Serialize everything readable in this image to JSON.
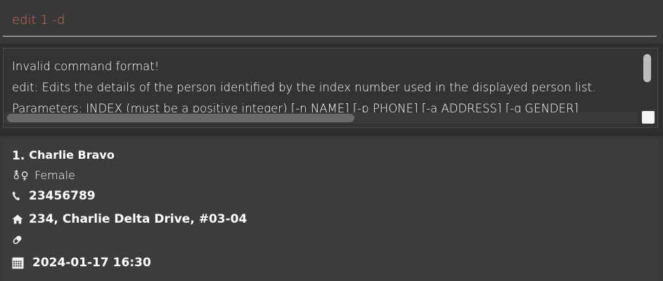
{
  "command_box": {
    "value": "edit 1 -d"
  },
  "result_display": {
    "lines": [
      "Invalid command format!",
      "edit: Edits the details of the person identified by the index number used in the displayed person list.",
      "Parameters: INDEX (must be a positive integer) [-n NAME] [-p PHONE] [-a ADDRESS] [-g GENDER]"
    ]
  },
  "person_list": {
    "cards": [
      {
        "index": "1.",
        "name": "Charlie Bravo",
        "gender": "Female",
        "gender_icon": "⚨♀",
        "phone": "23456789",
        "address": "234, Charlie Delta Drive, #03-04",
        "medicine": "",
        "appointment": "2024-01-17 16:30"
      }
    ]
  },
  "icons": {
    "phone": "phone-icon",
    "home": "home-icon",
    "medicine": "pill-icon",
    "appointment": "calendar-icon"
  }
}
